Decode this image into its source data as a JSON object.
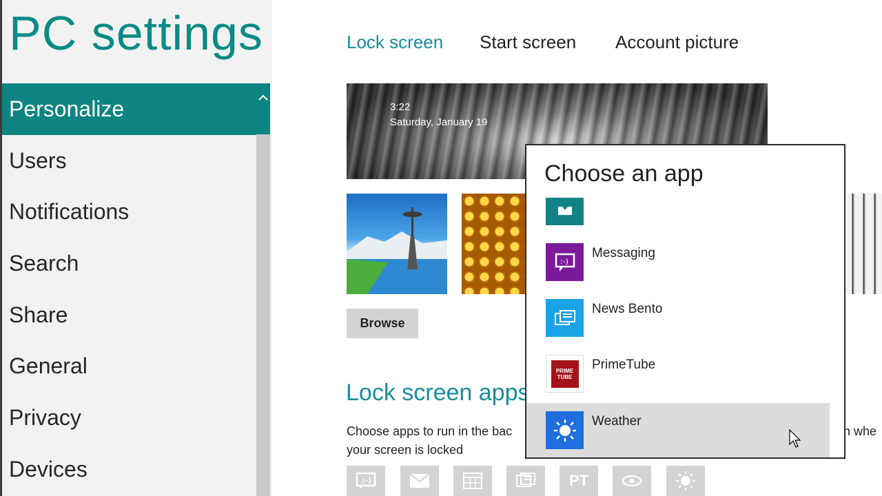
{
  "window": {
    "title": "PC settings"
  },
  "nav": {
    "items": [
      {
        "label": "Personalize",
        "selected": true
      },
      {
        "label": "Users"
      },
      {
        "label": "Notifications"
      },
      {
        "label": "Search"
      },
      {
        "label": "Share"
      },
      {
        "label": "General"
      },
      {
        "label": "Privacy"
      },
      {
        "label": "Devices"
      }
    ],
    "scroll_up_icon": "chevron-up-icon"
  },
  "tabs": [
    {
      "label": "Lock screen",
      "active": true
    },
    {
      "label": "Start screen"
    },
    {
      "label": "Account picture"
    }
  ],
  "lock_preview": {
    "time": "3:22",
    "date": "Saturday, January 19"
  },
  "browse_label": "Browse",
  "lock_screen_apps": {
    "heading": "Lock screen apps",
    "desc_line1": "Choose apps to run in the bac",
    "desc_line2": "your screen is locked",
    "desc_tail": "n whe",
    "slots": [
      {
        "icon": "messaging-icon"
      },
      {
        "icon": "mail-icon"
      },
      {
        "icon": "calendar-icon"
      },
      {
        "icon": "news-icon"
      },
      {
        "icon": "primetube-icon",
        "text": "PT"
      },
      {
        "icon": "eye-icon"
      },
      {
        "icon": "weather-icon"
      }
    ]
  },
  "flyout": {
    "title": "Choose an app",
    "apps": [
      {
        "name": "",
        "icon": "partial-app-icon",
        "color": "#138287"
      },
      {
        "name": "Messaging",
        "icon": "messaging-icon",
        "color": "#7a1a9b"
      },
      {
        "name": "News Bento",
        "icon": "news-bento-icon",
        "color": "#1aa3e6"
      },
      {
        "name": "PrimeTube",
        "icon": "primetube-icon",
        "color": "#a3141a"
      },
      {
        "name": "Weather",
        "icon": "weather-icon",
        "color": "#1f6fe0",
        "hovered": true
      }
    ]
  },
  "colors": {
    "accent": "#0d8481",
    "heading": "#1a8d9b"
  }
}
